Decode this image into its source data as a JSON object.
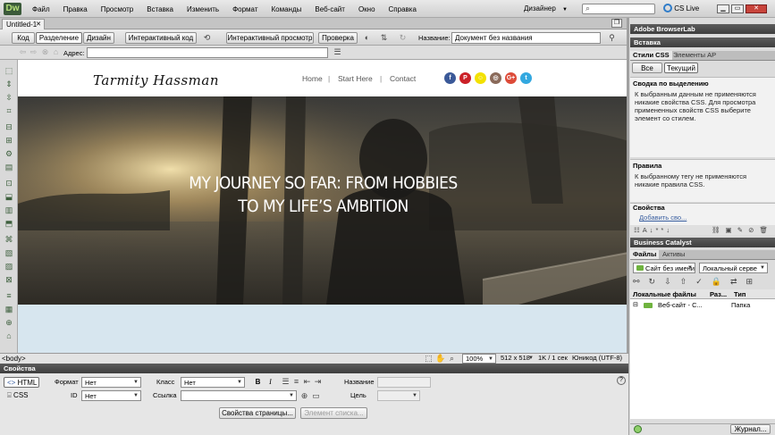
{
  "app": {
    "logo": "Dw",
    "menu": [
      "Файл",
      "Правка",
      "Просмотр",
      "Вставка",
      "Изменить",
      "Формат",
      "Команды",
      "Веб-сайт",
      "Окно",
      "Справка"
    ],
    "workspace": "Дизайнер",
    "cslive": "CS Live"
  },
  "doc_tab": "Untitled-1",
  "doc_toolbar": {
    "view_code": "Код",
    "view_split": "Разделение",
    "view_design": "Дизайн",
    "live_code": "Интерактивный код",
    "live_view": "Интерактивный просмотр",
    "inspect": "Проверка",
    "title_label": "Название:",
    "title_value": "Документ без названия"
  },
  "address": {
    "label": "Адрес:",
    "value": ""
  },
  "site": {
    "logo": "Tarmity Hassman",
    "nav": [
      "Home",
      "Start Here",
      "Contact"
    ],
    "nav_sep": "|",
    "social": [
      {
        "icon": "facebook-icon",
        "glyph": "f",
        "color": "#3b5998"
      },
      {
        "icon": "pinterest-icon",
        "glyph": "P",
        "color": "#cb2027"
      },
      {
        "icon": "snapchat-icon",
        "glyph": "☺",
        "color": "#f3e100"
      },
      {
        "icon": "instagram-icon",
        "glyph": "◎",
        "color": "#8a6a5a"
      },
      {
        "icon": "googleplus-icon",
        "glyph": "G+",
        "color": "#dd4b39"
      },
      {
        "icon": "twitter-icon",
        "glyph": "t",
        "color": "#33a8e0"
      }
    ],
    "hero_line1": "MY JOURNEY SO FAR: FROM HOBBIES",
    "hero_line2": "TO MY LIFE’S AMBITION"
  },
  "status": {
    "tag": "<body>",
    "zoom": "100%",
    "dims": "512 x 518",
    "size": "1K / 1 сек",
    "encoding": "Юникод (UTF-8)"
  },
  "props": {
    "title": "Свойства",
    "html": "HTML",
    "css": "CSS",
    "format_label": "Формат",
    "format_value": "Нет",
    "id_label": "ID",
    "id_value": "Нет",
    "class_label": "Класс",
    "class_value": "Нет",
    "link_label": "Ссылка",
    "link_value": "",
    "name_label": "Название",
    "target_label": "Цель",
    "page_props": "Свойства страницы...",
    "list_item": "Элемент списка...",
    "bold": "B",
    "italic": "I",
    "help": "?"
  },
  "panels": {
    "browserlab": "Adobe BrowserLab",
    "insert": "Вставка",
    "css_tab": "Стили CSS",
    "ap_tab": "Элементы AP",
    "all": "Все",
    "current": "Текущий",
    "summary_title": "Сводка по выделению",
    "summary_text": "К выбранным данным не применяются никакие свойства CSS.  Для просмотра примененных свойств CSS выберите элемент со стилем.",
    "rules_title": "Правила",
    "rules_text": "К выбранному тегу не применяются никакие правила CSS.",
    "props_title": "Свойства",
    "add_prop": "Добавить сво...",
    "bc": "Business Catalyst",
    "files_tab": "Файлы",
    "assets_tab": "Активы",
    "site_select": "Сайт без имени",
    "view_select": "Локальный серве",
    "col_local": "Локальные файлы",
    "col_size": "Раз...",
    "col_type": "Тип",
    "row_name": "Веб-сайт - С...",
    "row_type": "Папка",
    "log": "Журнал..."
  }
}
